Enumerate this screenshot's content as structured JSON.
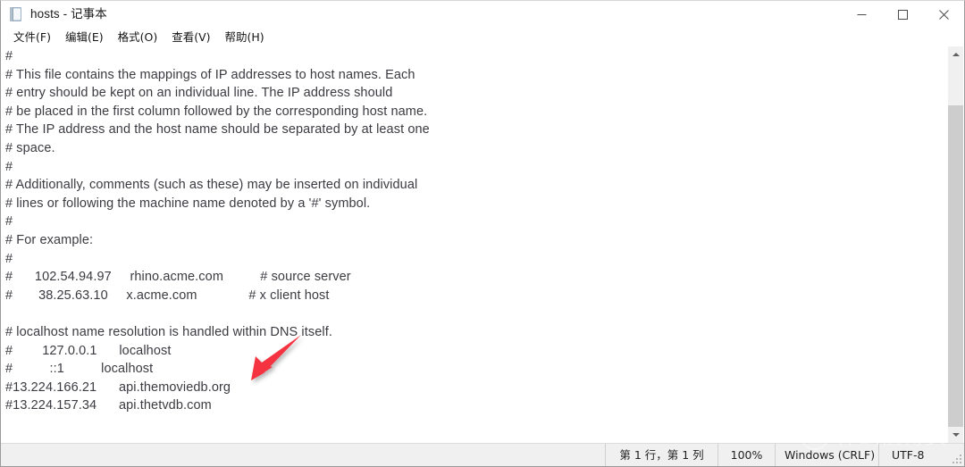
{
  "window": {
    "title": "hosts - 记事本",
    "app_icon": "notepad-icon",
    "controls": {
      "minimize": "minimize-icon",
      "maximize": "maximize-icon",
      "close": "close-icon"
    }
  },
  "menubar": {
    "items": [
      {
        "label": "文件(F)"
      },
      {
        "label": "编辑(E)"
      },
      {
        "label": "格式(O)"
      },
      {
        "label": "查看(V)"
      },
      {
        "label": "帮助(H)"
      }
    ]
  },
  "editor": {
    "lines": [
      "#",
      "# This file contains the mappings of IP addresses to host names. Each",
      "# entry should be kept on an individual line. The IP address should",
      "# be placed in the first column followed by the corresponding host name.",
      "# The IP address and the host name should be separated by at least one",
      "# space.",
      "#",
      "# Additionally, comments (such as these) may be inserted on individual",
      "# lines or following the machine name denoted by a '#' symbol.",
      "#",
      "# For example:",
      "#",
      "#      102.54.94.97     rhino.acme.com          # source server",
      "#       38.25.63.10     x.acme.com              # x client host",
      "",
      "# localhost name resolution is handled within DNS itself.",
      "#        127.0.0.1      localhost",
      "#          ::1          localhost",
      "#13.224.166.21      api.themoviedb.org",
      "#13.224.157.34      api.thetvdb.com"
    ]
  },
  "scrollbar": {
    "up_arrow": "scroll-up-icon",
    "down_arrow": "scroll-down-icon"
  },
  "statusbar": {
    "cursor_position": "第 1 行，第 1 列",
    "zoom": "100%",
    "line_ending": "Windows (CRLF)",
    "encoding": "UTF-8"
  },
  "annotation": {
    "arrow_color": "#f5333f",
    "arrow_name": "red-pointer-arrow"
  },
  "watermark": {
    "text": "什么值得买",
    "badge": "值"
  }
}
